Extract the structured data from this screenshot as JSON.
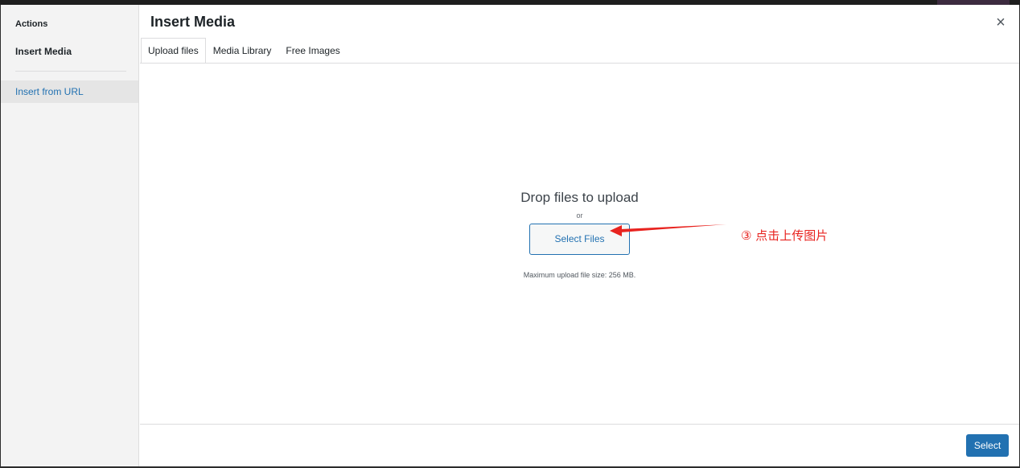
{
  "sidebar": {
    "heading": "Actions",
    "items": [
      {
        "label": "Insert Media"
      },
      {
        "label": "Insert from URL"
      }
    ]
  },
  "modal": {
    "title": "Insert Media",
    "close_symbol": "×",
    "tabs": [
      {
        "label": "Upload files"
      },
      {
        "label": "Media Library"
      },
      {
        "label": "Free Images"
      }
    ]
  },
  "upload": {
    "drop_text": "Drop files to upload",
    "or_text": "or",
    "select_files_label": "Select Files",
    "max_size_text": "Maximum upload file size: 256 MB."
  },
  "annotation": {
    "text": "③ 点击上传图片",
    "color": "#e8231f"
  },
  "toolbar": {
    "select_label": "Select"
  },
  "colors": {
    "accent": "#2271b1",
    "sidebar_bg": "#f3f3f3"
  }
}
